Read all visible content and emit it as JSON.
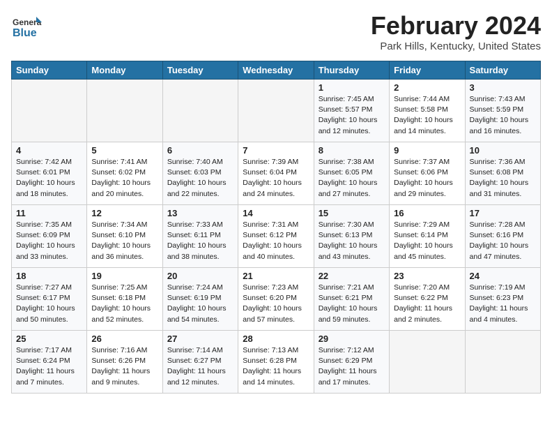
{
  "header": {
    "logo_general": "General",
    "logo_blue": "Blue",
    "month_title": "February 2024",
    "location": "Park Hills, Kentucky, United States"
  },
  "weekdays": [
    "Sunday",
    "Monday",
    "Tuesday",
    "Wednesday",
    "Thursday",
    "Friday",
    "Saturday"
  ],
  "weeks": [
    [
      {
        "day": "",
        "info": ""
      },
      {
        "day": "",
        "info": ""
      },
      {
        "day": "",
        "info": ""
      },
      {
        "day": "",
        "info": ""
      },
      {
        "day": "1",
        "info": "Sunrise: 7:45 AM\nSunset: 5:57 PM\nDaylight: 10 hours\nand 12 minutes."
      },
      {
        "day": "2",
        "info": "Sunrise: 7:44 AM\nSunset: 5:58 PM\nDaylight: 10 hours\nand 14 minutes."
      },
      {
        "day": "3",
        "info": "Sunrise: 7:43 AM\nSunset: 5:59 PM\nDaylight: 10 hours\nand 16 minutes."
      }
    ],
    [
      {
        "day": "4",
        "info": "Sunrise: 7:42 AM\nSunset: 6:01 PM\nDaylight: 10 hours\nand 18 minutes."
      },
      {
        "day": "5",
        "info": "Sunrise: 7:41 AM\nSunset: 6:02 PM\nDaylight: 10 hours\nand 20 minutes."
      },
      {
        "day": "6",
        "info": "Sunrise: 7:40 AM\nSunset: 6:03 PM\nDaylight: 10 hours\nand 22 minutes."
      },
      {
        "day": "7",
        "info": "Sunrise: 7:39 AM\nSunset: 6:04 PM\nDaylight: 10 hours\nand 24 minutes."
      },
      {
        "day": "8",
        "info": "Sunrise: 7:38 AM\nSunset: 6:05 PM\nDaylight: 10 hours\nand 27 minutes."
      },
      {
        "day": "9",
        "info": "Sunrise: 7:37 AM\nSunset: 6:06 PM\nDaylight: 10 hours\nand 29 minutes."
      },
      {
        "day": "10",
        "info": "Sunrise: 7:36 AM\nSunset: 6:08 PM\nDaylight: 10 hours\nand 31 minutes."
      }
    ],
    [
      {
        "day": "11",
        "info": "Sunrise: 7:35 AM\nSunset: 6:09 PM\nDaylight: 10 hours\nand 33 minutes."
      },
      {
        "day": "12",
        "info": "Sunrise: 7:34 AM\nSunset: 6:10 PM\nDaylight: 10 hours\nand 36 minutes."
      },
      {
        "day": "13",
        "info": "Sunrise: 7:33 AM\nSunset: 6:11 PM\nDaylight: 10 hours\nand 38 minutes."
      },
      {
        "day": "14",
        "info": "Sunrise: 7:31 AM\nSunset: 6:12 PM\nDaylight: 10 hours\nand 40 minutes."
      },
      {
        "day": "15",
        "info": "Sunrise: 7:30 AM\nSunset: 6:13 PM\nDaylight: 10 hours\nand 43 minutes."
      },
      {
        "day": "16",
        "info": "Sunrise: 7:29 AM\nSunset: 6:14 PM\nDaylight: 10 hours\nand 45 minutes."
      },
      {
        "day": "17",
        "info": "Sunrise: 7:28 AM\nSunset: 6:16 PM\nDaylight: 10 hours\nand 47 minutes."
      }
    ],
    [
      {
        "day": "18",
        "info": "Sunrise: 7:27 AM\nSunset: 6:17 PM\nDaylight: 10 hours\nand 50 minutes."
      },
      {
        "day": "19",
        "info": "Sunrise: 7:25 AM\nSunset: 6:18 PM\nDaylight: 10 hours\nand 52 minutes."
      },
      {
        "day": "20",
        "info": "Sunrise: 7:24 AM\nSunset: 6:19 PM\nDaylight: 10 hours\nand 54 minutes."
      },
      {
        "day": "21",
        "info": "Sunrise: 7:23 AM\nSunset: 6:20 PM\nDaylight: 10 hours\nand 57 minutes."
      },
      {
        "day": "22",
        "info": "Sunrise: 7:21 AM\nSunset: 6:21 PM\nDaylight: 10 hours\nand 59 minutes."
      },
      {
        "day": "23",
        "info": "Sunrise: 7:20 AM\nSunset: 6:22 PM\nDaylight: 11 hours\nand 2 minutes."
      },
      {
        "day": "24",
        "info": "Sunrise: 7:19 AM\nSunset: 6:23 PM\nDaylight: 11 hours\nand 4 minutes."
      }
    ],
    [
      {
        "day": "25",
        "info": "Sunrise: 7:17 AM\nSunset: 6:24 PM\nDaylight: 11 hours\nand 7 minutes."
      },
      {
        "day": "26",
        "info": "Sunrise: 7:16 AM\nSunset: 6:26 PM\nDaylight: 11 hours\nand 9 minutes."
      },
      {
        "day": "27",
        "info": "Sunrise: 7:14 AM\nSunset: 6:27 PM\nDaylight: 11 hours\nand 12 minutes."
      },
      {
        "day": "28",
        "info": "Sunrise: 7:13 AM\nSunset: 6:28 PM\nDaylight: 11 hours\nand 14 minutes."
      },
      {
        "day": "29",
        "info": "Sunrise: 7:12 AM\nSunset: 6:29 PM\nDaylight: 11 hours\nand 17 minutes."
      },
      {
        "day": "",
        "info": ""
      },
      {
        "day": "",
        "info": ""
      }
    ]
  ]
}
